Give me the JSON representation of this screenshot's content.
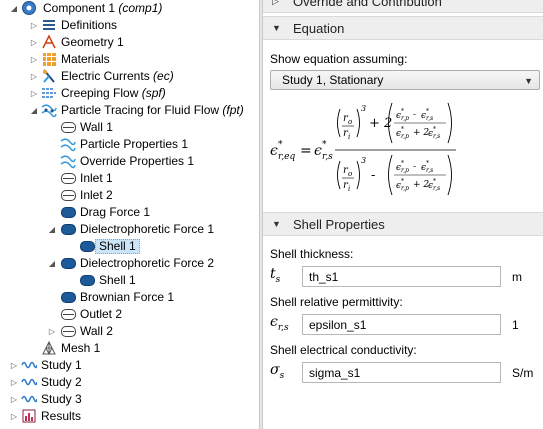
{
  "tree": {
    "items": [
      {
        "label": "Component 1",
        "suffix": "(comp1)"
      },
      {
        "label": "Definitions"
      },
      {
        "label": "Geometry 1"
      },
      {
        "label": "Materials"
      },
      {
        "label": "Electric Currents",
        "suffix": "(ec)"
      },
      {
        "label": "Creeping Flow",
        "suffix": "(spf)"
      },
      {
        "label": "Particle Tracing for Fluid Flow",
        "suffix": "(fpt)"
      },
      {
        "label": "Wall 1"
      },
      {
        "label": "Particle Properties 1"
      },
      {
        "label": "Override Properties 1"
      },
      {
        "label": "Inlet 1"
      },
      {
        "label": "Inlet 2"
      },
      {
        "label": "Drag Force 1"
      },
      {
        "label": "Dielectrophoretic Force 1"
      },
      {
        "label": "Shell 1"
      },
      {
        "label": "Dielectrophoretic Force 2"
      },
      {
        "label": "Shell 1"
      },
      {
        "label": "Brownian Force 1"
      },
      {
        "label": "Outlet 2"
      },
      {
        "label": "Wall 2"
      },
      {
        "label": "Mesh 1"
      },
      {
        "label": "Study 1"
      },
      {
        "label": "Study 2"
      },
      {
        "label": "Study 3"
      },
      {
        "label": "Results"
      }
    ]
  },
  "settings": {
    "top_section_title": "Override and Contribution",
    "equation": {
      "title": "Equation",
      "show_label": "Show equation assuming:",
      "selected_study": "Study 1, Stationary"
    },
    "shell": {
      "title": "Shell Properties",
      "thickness_label": "Shell thickness:",
      "thickness_symbol": "t",
      "thickness_sub": "s",
      "thickness_value": "th_s1",
      "thickness_unit": "m",
      "permittivity_label": "Shell relative permittivity:",
      "permittivity_symbol": "ϵ",
      "permittivity_sub": "r,s",
      "permittivity_value": "epsilon_s1",
      "permittivity_unit": "1",
      "conductivity_label": "Shell electrical conductivity:",
      "conductivity_symbol": "σ",
      "conductivity_sub": "s",
      "conductivity_value": "sigma_s1",
      "conductivity_unit": "S/m"
    }
  }
}
